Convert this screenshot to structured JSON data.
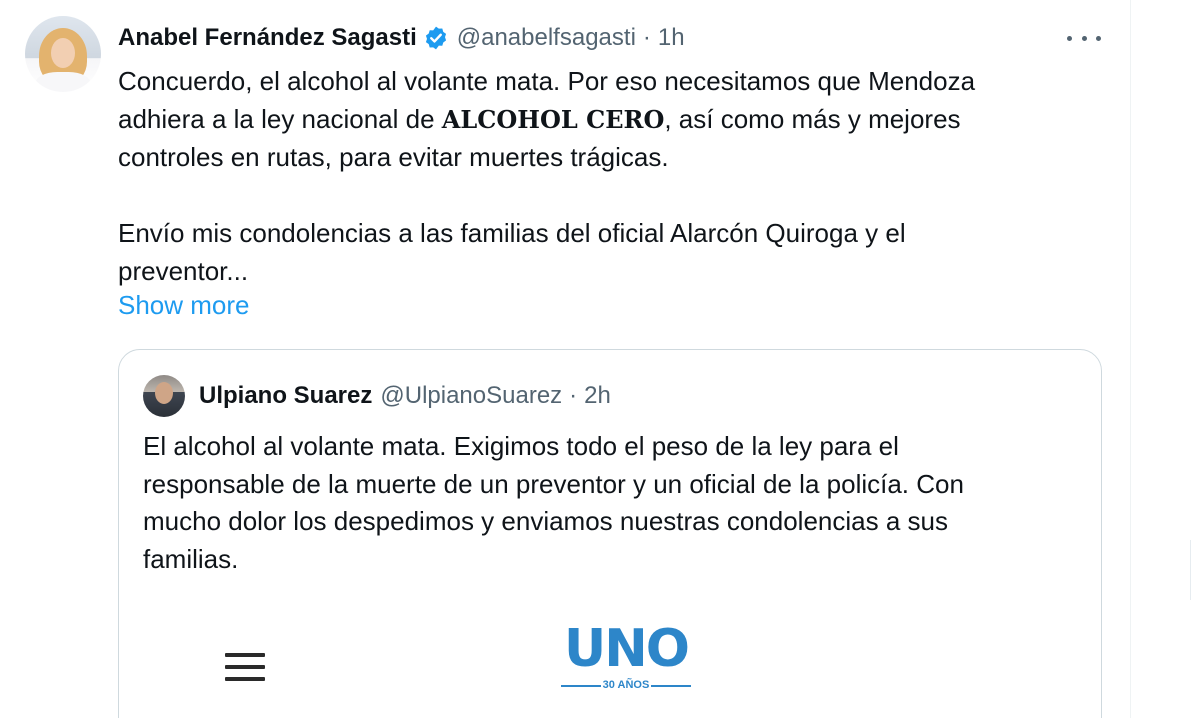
{
  "tweet": {
    "author_name": "Anabel Fernández Sagasti",
    "handle": "@anabelfsagasti",
    "separator": "·",
    "time": "1h",
    "text_line1": "Concuerdo, el alcohol al volante mata. Por eso necesitamos que Mendoza",
    "text_line2_pre": "adhiera a la ley nacional de ",
    "text_line2_bold": "ALCOHOL CERO",
    "text_line2_post": ", así como más y mejores",
    "text_line3": "controles en rutas, para evitar muertes trágicas.",
    "text_line4": "Envío mis condolencias a las familias del oficial Alarcón Quiroga y el",
    "text_line5": "preventor...",
    "show_more": "Show more"
  },
  "quoted": {
    "author_name": "Ulpiano Suarez",
    "handle": "@UlpianoSuarez",
    "separator": "·",
    "time": "2h",
    "text_lines": [
      "El alcohol al volante mata. Exigimos todo el peso de la ley para el",
      "responsable de la muerte de un preventor y un oficial de la policía. Con",
      "mucho dolor los despedimos y enviamos nuestras condolencias a sus",
      "familias."
    ],
    "media": {
      "logo_text": "UNO",
      "logo_subtext": "30 AÑOS"
    }
  },
  "colors": {
    "link": "#1d9bf0",
    "secondary_text": "#536471",
    "logo_blue": "#2d86c9"
  }
}
